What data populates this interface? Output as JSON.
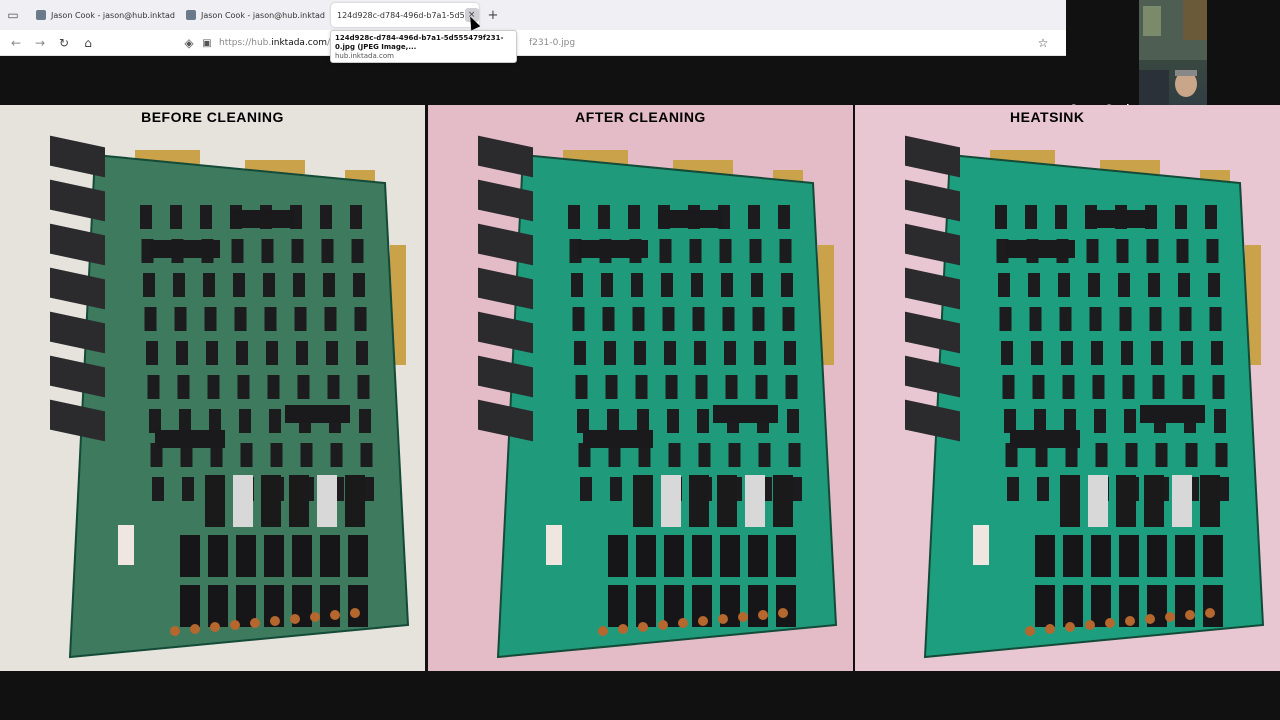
{
  "browser": {
    "tabs": [
      {
        "title": "Jason Cook - jason@hub.inktad",
        "close": "×"
      },
      {
        "title": "Jason Cook - jason@hub.inktad",
        "close": "×"
      },
      {
        "title": "124d928c-d784-496d-b7a1-5d5",
        "close": "×"
      }
    ],
    "new_tab": "+",
    "url_prefix": "https://hub.",
    "url_host": "inktada.com",
    "url_path": "/pl",
    "url_tail": "f231-0.jpg",
    "tooltip": {
      "title": "124d928c-d784-496d-b7a1-5d555479f231-0.jpg (JPEG Image,...",
      "subtitle": "hub.inktada.com"
    }
  },
  "panels": [
    {
      "label": "BEFORE CLEANING",
      "board_color": "#3d7a5e",
      "bg": "#e6e2dc"
    },
    {
      "label": "AFTER CLEANING",
      "board_color": "#1f9a7a",
      "bg": "#e4bcc8"
    },
    {
      "label": "HEATSINK",
      "board_color": "#1d9e7e",
      "bg": "#e8c6d2"
    }
  ],
  "webcam": {
    "name": "Jason Cook"
  }
}
